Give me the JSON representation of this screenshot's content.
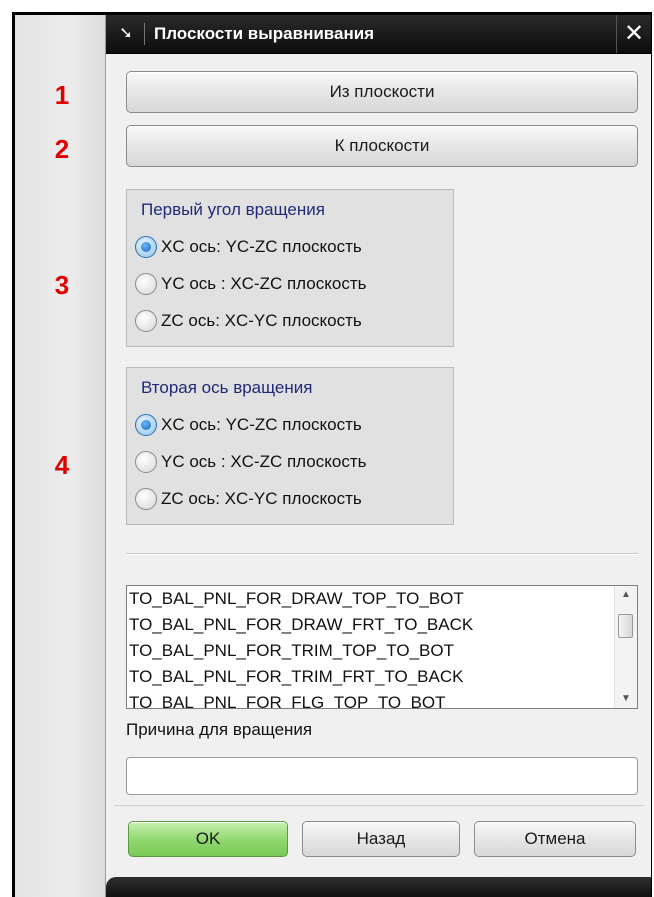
{
  "dialog": {
    "title": "Плоскости выравнивания",
    "close_symbol": "✕",
    "title_icon": "arrow-cursor-icon"
  },
  "markers": [
    "1",
    "2",
    "3",
    "4"
  ],
  "buttons": {
    "from_plane": "Из плоскости",
    "to_plane": "К плоскости"
  },
  "first_rotation": {
    "title": "Первый угол вращения",
    "options": [
      {
        "label": "XC ось:  YC-ZC плоскость",
        "checked": true
      },
      {
        "label": "YC ось : XC-ZC плоскость",
        "checked": false
      },
      {
        "label": "ZC ось: XC-YC плоскость",
        "checked": false
      }
    ]
  },
  "second_rotation": {
    "title": "Вторая ось вращения",
    "options": [
      {
        "label": "XC ось:  YC-ZC плоскость",
        "checked": true
      },
      {
        "label": "YC ось : XC-ZC плоскость",
        "checked": false
      },
      {
        "label": "ZC ось: XC-YC плоскость",
        "checked": false
      }
    ]
  },
  "reasons_list": {
    "items": [
      "TO_BAL_PNL_FOR_DRAW_TOP_TO_BOT",
      "TO_BAL_PNL_FOR_DRAW_FRT_TO_BACK",
      "TO_BAL_PNL_FOR_TRIM_TOP_TO_BOT",
      "TO_BAL_PNL_FOR_TRIM_FRT_TO_BACK",
      "TO_BAL_PNL_FOR_FLG_TOP_TO_BOT"
    ],
    "scroll_up": "▲",
    "scroll_down": "▼"
  },
  "reason_field": {
    "label": "Причина для вращения",
    "value": ""
  },
  "footer": {
    "ok": "OK",
    "back": "Назад",
    "cancel": "Отмена"
  }
}
